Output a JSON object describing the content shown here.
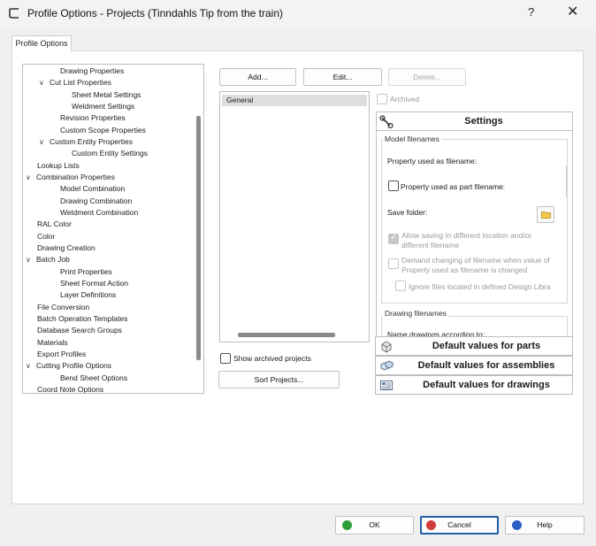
{
  "window": {
    "title": "Profile Options - Projects (Tinndahls Tip from the train)",
    "help_label": "?",
    "close_label": "✕"
  },
  "tab": {
    "label": "Profile Options"
  },
  "tree": {
    "items": [
      {
        "label": "Drawing Properties",
        "level": 2,
        "expander": false
      },
      {
        "label": "Cut List Properties",
        "level": 1,
        "expander": true
      },
      {
        "label": "Sheet Metal Settings",
        "level": 3,
        "expander": false
      },
      {
        "label": "Weldment Settings",
        "level": 3,
        "expander": false
      },
      {
        "label": "Revision Properties",
        "level": 2,
        "expander": false
      },
      {
        "label": "Custom Scope Properties",
        "level": 2,
        "expander": false
      },
      {
        "label": "Custom Entity Properties",
        "level": 1,
        "expander": true
      },
      {
        "label": "Custom Entity Settings",
        "level": 3,
        "expander": false
      },
      {
        "label": "Lookup Lists",
        "level": 0,
        "expander": false
      },
      {
        "label": "Combination Properties",
        "level": -1,
        "expander": true
      },
      {
        "label": "Model Combination",
        "level": 2,
        "expander": false
      },
      {
        "label": "Drawing Combination",
        "level": 2,
        "expander": false
      },
      {
        "label": "Weldment Combination",
        "level": 2,
        "expander": false
      },
      {
        "label": "RAL Color",
        "level": 0,
        "expander": false
      },
      {
        "label": "Color",
        "level": 0,
        "expander": false
      },
      {
        "label": "Drawing Creation",
        "level": 0,
        "expander": false
      },
      {
        "label": "Batch Job",
        "level": -1,
        "expander": true
      },
      {
        "label": "Print Properties",
        "level": 2,
        "expander": false
      },
      {
        "label": "Sheet Format Action",
        "level": 2,
        "expander": false
      },
      {
        "label": "Layer Definitions",
        "level": 2,
        "expander": false
      },
      {
        "label": "File Conversion",
        "level": 0,
        "expander": false
      },
      {
        "label": "Batch Operation Templates",
        "level": 0,
        "expander": false
      },
      {
        "label": "Database Search Groups",
        "level": 0,
        "expander": false
      },
      {
        "label": "Materials",
        "level": 0,
        "expander": false
      },
      {
        "label": "Export Profiles",
        "level": 0,
        "expander": false
      },
      {
        "label": "Cutting Profile Options",
        "level": -1,
        "expander": true
      },
      {
        "label": "Bend Sheet Options",
        "level": 2,
        "expander": false
      },
      {
        "label": "Coord Note Options",
        "level": 0,
        "expander": false
      }
    ]
  },
  "toolbar": {
    "add_label": "Add...",
    "edit_label": "Edit...",
    "delete_label": "Delete..."
  },
  "projects": {
    "items": [
      "General"
    ],
    "show_archived_label": "Show archived projects",
    "sort_label": "Sort Projects...",
    "archived_label": "Archived"
  },
  "settings": {
    "title": "Settings",
    "model_filenames": {
      "group_title": "Model filenames",
      "property_used_label": "Property used as filename:",
      "property_part_label": "Property used as part filename:",
      "save_folder_label": "Save folder:",
      "allow_saving_label_1": "Allow saving in different location and/or",
      "allow_saving_label_2": "different filename",
      "demand_change_label_1": "Demand changing of filename when value of",
      "demand_change_label_2": "Property used as filename is changed",
      "ignore_files_label": "Ignore files located in defined Design Libra"
    },
    "drawing_filenames": {
      "group_title": "Drawing filenames",
      "name_drawings_label": "Name drawings according to:"
    }
  },
  "accordion": {
    "parts_label": "Default values for parts",
    "assemblies_label": "Default values for assemblies",
    "drawings_label": "Default values for drawings"
  },
  "footer": {
    "ok_label": "OK",
    "cancel_label": "Cancel",
    "help_label": "Help"
  },
  "colors": {
    "default_button_border": "#1f5fa8",
    "ok_icon": "#2e9e3a",
    "cancel_icon": "#d23b3b",
    "help_icon": "#2d5fc4"
  }
}
